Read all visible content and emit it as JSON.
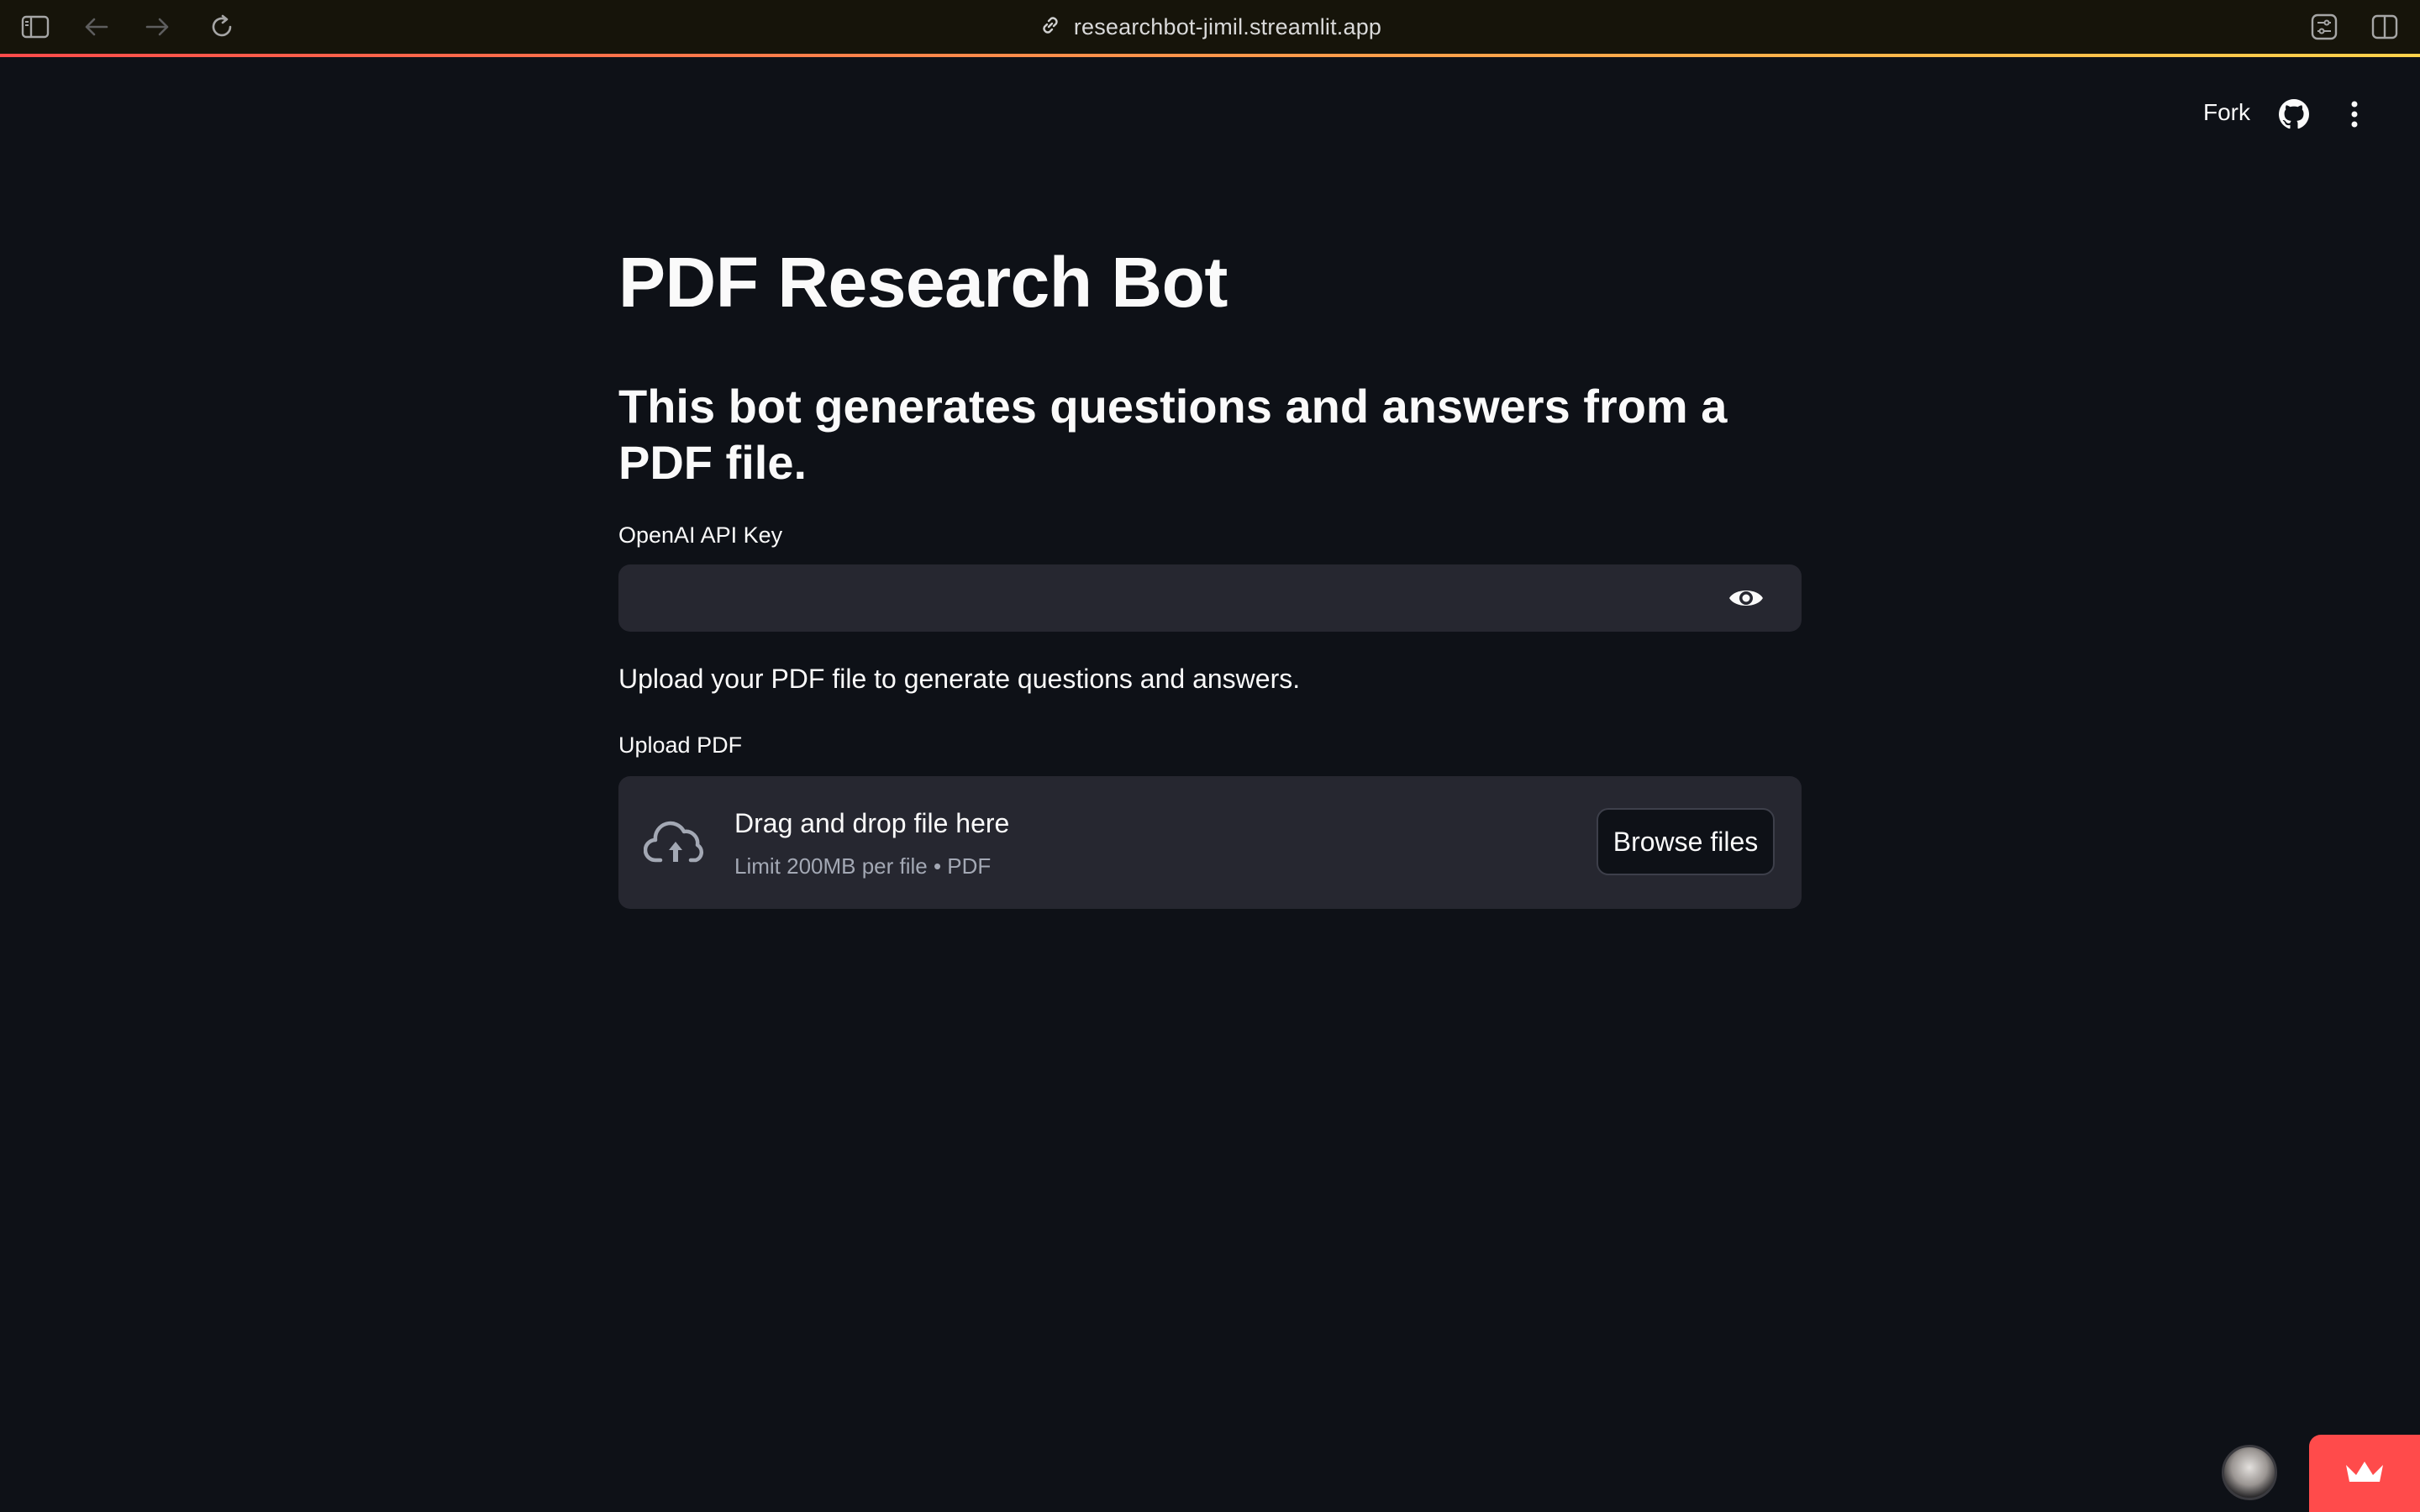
{
  "browser": {
    "url": "researchbot-jimil.streamlit.app"
  },
  "header": {
    "fork_label": "Fork"
  },
  "main": {
    "title": "PDF Research Bot",
    "subtitle": "This bot generates questions and answers from a PDF file.",
    "api_key": {
      "label": "OpenAI API Key",
      "value": ""
    },
    "upload_instruction": "Upload your PDF file to generate questions and answers.",
    "uploader": {
      "label": "Upload PDF",
      "title": "Drag and drop file here",
      "subtitle": "Limit 200MB per file • PDF",
      "browse_label": "Browse files"
    }
  },
  "colors": {
    "background": "#0e1117",
    "input_bg": "#262730",
    "accent": "#ff4b4b",
    "muted_text": "#a3a8b4"
  },
  "icons": {
    "sidebar": "sidebar-toggle-icon",
    "back": "arrow-left-icon",
    "forward": "arrow-right-icon",
    "reload": "reload-icon",
    "link": "link-icon",
    "extension": "extension-icon",
    "split": "split-view-icon",
    "github": "github-icon",
    "menu": "kebab-menu-icon",
    "eye": "eye-icon",
    "upload": "cloud-upload-icon",
    "crown": "crown-icon"
  }
}
